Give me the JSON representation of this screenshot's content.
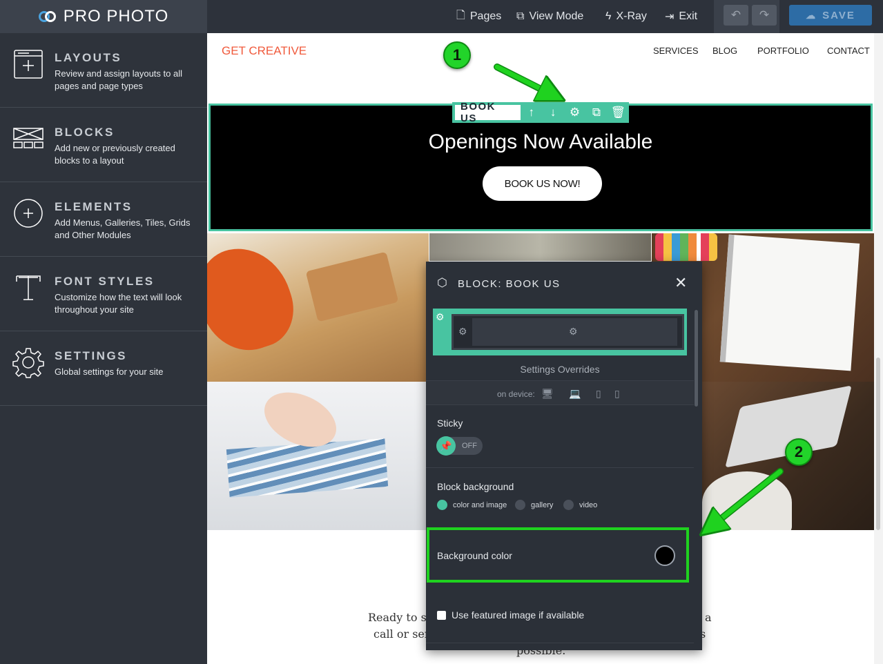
{
  "app": {
    "logo_text": "PRO PHOTO",
    "top_nav": {
      "pages": "Pages",
      "view_mode": "View Mode",
      "xray": "X-Ray",
      "exit": "Exit"
    },
    "save_label": "SAVE"
  },
  "sidebar": {
    "items": [
      {
        "title": "LAYOUTS",
        "desc": "Review and assign layouts to all pages and page types",
        "icon": "layouts-icon"
      },
      {
        "title": "BLOCKS",
        "desc": "Add new or previously created blocks to a layout",
        "icon": "blocks-icon"
      },
      {
        "title": "ELEMENTS",
        "desc": "Add Menus, Galleries, Tiles, Grids and Other Modules",
        "icon": "elements-icon"
      },
      {
        "title": "FONT STYLES",
        "desc": "Customize how the text will look throughout your site",
        "icon": "font-icon"
      },
      {
        "title": "SETTINGS",
        "desc": "Global settings for your site",
        "icon": "gear-icon"
      }
    ]
  },
  "site": {
    "brand": "GET CREATIVE",
    "nav": [
      "SERVICES",
      "BLOG",
      "PORTFOLIO",
      "CONTACT"
    ],
    "block_label": "BOOK US",
    "block_heading": "Openings Now Available",
    "block_button": "BOOK US NOW!",
    "body_lines": [
      "Ready to st",
      "call or ser",
      "possible."
    ],
    "body_tail": [
      "a",
      "s"
    ]
  },
  "annotations": {
    "badge_1": "1",
    "badge_2": "2",
    "highlight_color": "#1fd21f"
  },
  "panel": {
    "title": "BLOCK: BOOK US",
    "close": "✕",
    "overrides_label": "Settings Overrides",
    "device_label": "on device:",
    "sticky_label": "Sticky",
    "sticky_state": "OFF",
    "background_label": "Block background",
    "background_options": [
      "color and image",
      "gallery",
      "video"
    ],
    "background_selected": "color and image",
    "bgcolor_label": "Background color",
    "bgcolor_value": "#000000",
    "featured_label": "Use featured image if available"
  },
  "colors": {
    "accent": "#48c4a1",
    "save_button": "#2d6ca5",
    "brand": "#f05a3c"
  }
}
